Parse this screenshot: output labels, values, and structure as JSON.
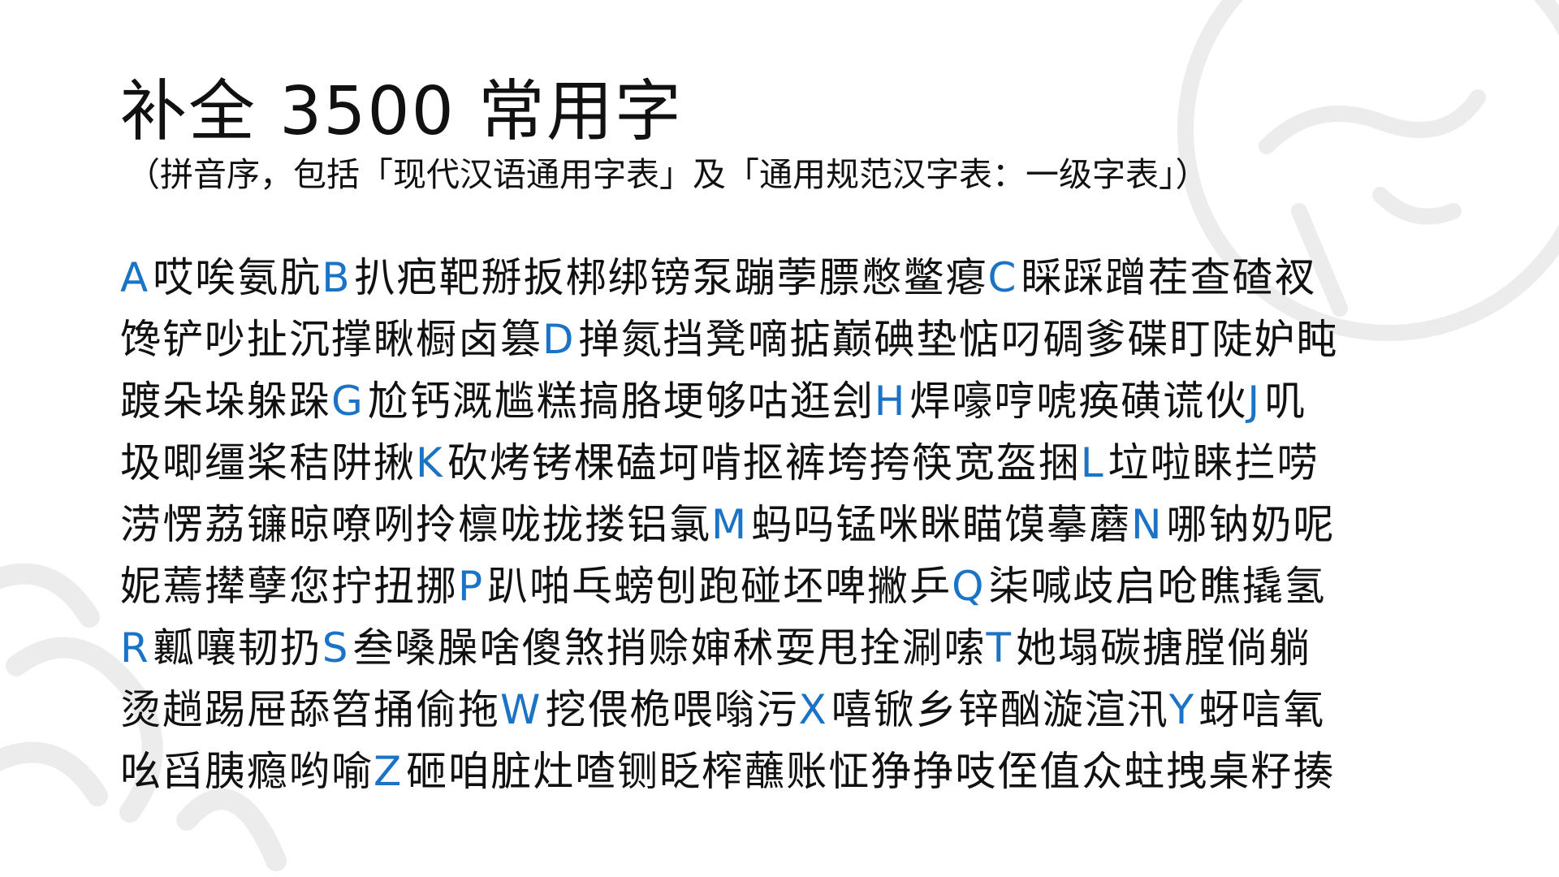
{
  "page": {
    "title": "补全 3500 常用字",
    "subtitle": "（拼音序，包括「现代汉语通用字表」及「通用规范汉字表：一级字表」）"
  },
  "colors": {
    "letter_accent": "#1a73c4",
    "text": "#111111",
    "watermark": "#ececec"
  },
  "rows": [
    {
      "segments": [
        {
          "letter": "A",
          "text": "哎唉氨肮"
        },
        {
          "letter": "B",
          "text": "扒疤靶掰扳梆绑镑泵蹦荸膘憋鳖瘪"
        },
        {
          "letter": "C",
          "text": "睬踩蹭茬查碴衩"
        }
      ]
    },
    {
      "segments": [
        {
          "letter": "",
          "text": "馋铲吵扯沉撑瞅橱卤篡"
        },
        {
          "letter": "D",
          "text": "掸氮挡凳嘀掂巅碘垫惦叼碉爹碟盯陡妒盹"
        }
      ]
    },
    {
      "segments": [
        {
          "letter": "",
          "text": "踱朵垛躲跺"
        },
        {
          "letter": "G",
          "text": "尬钙溉尴糕搞胳埂够咕逛刽"
        },
        {
          "letter": "H",
          "text": "焊嚎哼唬痪磺谎伙"
        },
        {
          "letter": "J",
          "text": "叽"
        }
      ]
    },
    {
      "segments": [
        {
          "letter": "",
          "text": "圾唧缰桨秸阱揪"
        },
        {
          "letter": "K",
          "text": "砍烤铐棵磕坷啃抠裤垮挎筷宽盔捆"
        },
        {
          "letter": "L",
          "text": "垃啦睐拦唠"
        }
      ]
    },
    {
      "segments": [
        {
          "letter": "",
          "text": "涝愣荔镰晾嘹咧拎檩咙拢搂铝氯"
        },
        {
          "letter": "M",
          "text": "蚂吗锰咪眯瞄馍摹蘑"
        },
        {
          "letter": "N",
          "text": "哪钠奶呢"
        }
      ]
    },
    {
      "segments": [
        {
          "letter": "",
          "text": "妮蔫撵孽您拧扭挪"
        },
        {
          "letter": "P",
          "text": "趴啪乓螃刨跑碰坯啤撇乒"
        },
        {
          "letter": "Q",
          "text": "柒喊歧启呛瞧撬氢"
        }
      ]
    },
    {
      "segments": [
        {
          "letter": "R",
          "text": "瓤嚷韧扔"
        },
        {
          "letter": "S",
          "text": "叁嗓臊啥傻煞捎赊婶秫耍甩拴涮嗦"
        },
        {
          "letter": "T",
          "text": "她塌碳搪膛倘躺"
        }
      ]
    },
    {
      "segments": [
        {
          "letter": "",
          "text": "烫趟踢屉舔笤捅偷拖"
        },
        {
          "letter": "W",
          "text": "挖偎桅喂嗡污"
        },
        {
          "letter": "X",
          "text": "嘻锨乡锌酗漩渲汛"
        },
        {
          "letter": "Y",
          "text": "蚜唁氧"
        }
      ]
    },
    {
      "segments": [
        {
          "letter": "",
          "text": "吆舀胰瘾哟喻"
        },
        {
          "letter": "Z",
          "text": "砸咱脏灶喳铡眨榨蘸账怔狰挣吱侄值众蛀拽桌籽揍"
        }
      ]
    }
  ]
}
